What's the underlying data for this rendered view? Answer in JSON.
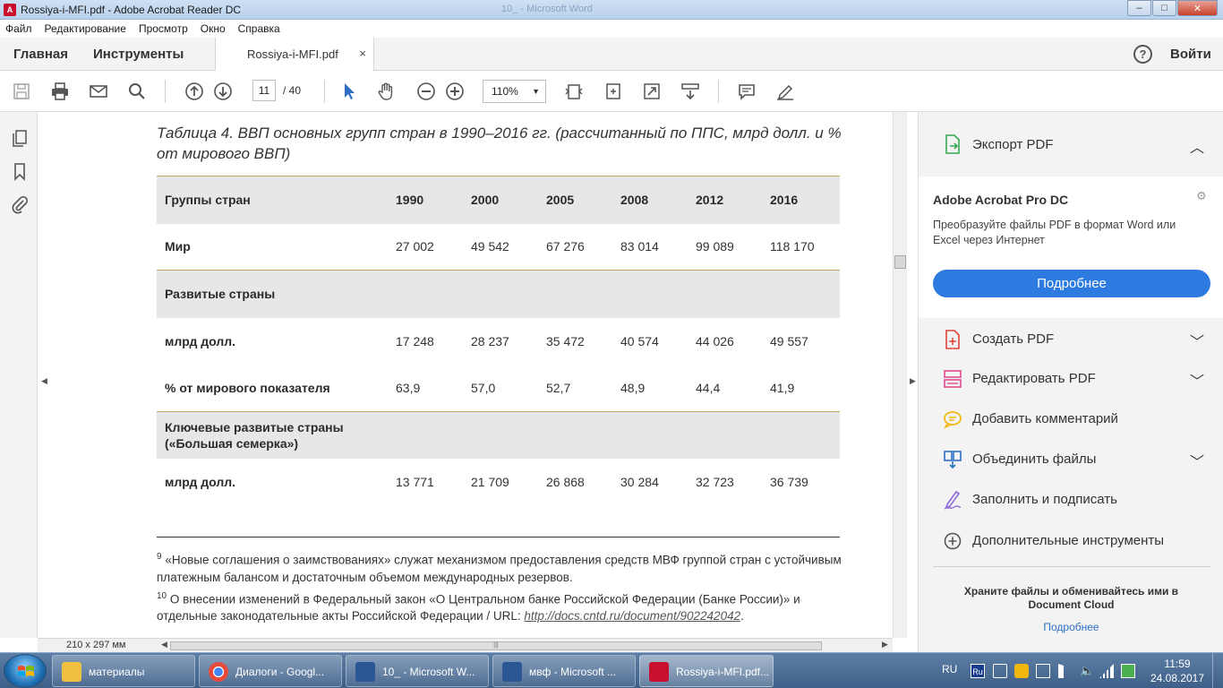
{
  "window": {
    "title": "Rossiya-i-MFI.pdf - Adobe Acrobat Reader DC",
    "ghost_title": "10_ - Microsoft Word",
    "controls": {
      "minimize": "–",
      "maximize": "□",
      "close": "✕"
    }
  },
  "menu": [
    "Файл",
    "Редактирование",
    "Просмотр",
    "Окно",
    "Справка"
  ],
  "nav": {
    "home": "Главная",
    "tools": "Инструменты",
    "doc_tab": "Rossiya-i-MFI.pdf",
    "close_tab": "×",
    "help": "?",
    "login": "Войти"
  },
  "toolbar": {
    "page_current": "11",
    "page_total": "/  40",
    "zoom": "110%"
  },
  "document": {
    "caption": "Таблица 4. ВВП основных групп стран в 1990–2016 гг. (рассчитанный по ППС, млрд долл. и % от мирового ВВП)",
    "header": {
      "label": "Группы стран",
      "years": [
        "1990",
        "2000",
        "2005",
        "2008",
        "2012",
        "2016"
      ]
    },
    "rows": [
      {
        "label": "Мир",
        "values": [
          "27 002",
          "49 542",
          "67 276",
          "83 014",
          "99 089",
          "118 170"
        ]
      },
      {
        "label": "Развитые страны",
        "values": []
      },
      {
        "label": "млрд долл.",
        "values": [
          "17 248",
          "28 237",
          "35 472",
          "40 574",
          "44 026",
          "49 557"
        ]
      },
      {
        "label": "% от мирового показателя",
        "values": [
          "63,9",
          "57,0",
          "52,7",
          "48,9",
          "44,4",
          "41,9"
        ]
      },
      {
        "label": "Ключевые развитые страны\n(«Большая семерка»)",
        "values": []
      },
      {
        "label": "млрд долл.",
        "values": [
          "13 771",
          "21 709",
          "26 868",
          "30 284",
          "32 723",
          "36 739"
        ]
      }
    ],
    "footnotes": [
      {
        "num": "9",
        "text": "«Новые соглашения о заимствованиях» служат механизмом предоставления средств МВФ группой стран с устойчивым платежным балансом и достаточным объемом международных резервов."
      },
      {
        "num": "10",
        "text": "О внесении изменений в Федеральный закон «О Центральном банке Российской Федерации (Банке России)» и отдельные законодательные акты Российской Федерации / URL: ",
        "link": "http://docs.cntd.ru/document/902242042",
        "after": "."
      }
    ]
  },
  "status": {
    "page_size": "210 x 297 мм"
  },
  "right_panel": {
    "export_label": "Экспорт PDF",
    "promo_title": "Adobe Acrobat Pro DC",
    "promo_desc": "Преобразуйте файлы PDF в формат Word или Excel через Интернет",
    "promo_button": "Подробнее",
    "tools": [
      {
        "label": "Создать PDF",
        "expandable": true,
        "color": "#e0433a"
      },
      {
        "label": "Редактировать PDF",
        "expandable": true,
        "color": "#e04a8c"
      },
      {
        "label": "Добавить комментарий",
        "expandable": false,
        "color": "#f2b80f"
      },
      {
        "label": "Объединить файлы",
        "expandable": true,
        "color": "#2d6fc4"
      },
      {
        "label": "Заполнить и подписать",
        "expandable": false,
        "color": "#8f6ad8"
      },
      {
        "label": "Дополнительные инструменты",
        "expandable": false,
        "color": "#555555"
      }
    ],
    "cloud_title": "Храните файлы и обменивайтесь ими в Document Cloud",
    "cloud_link": "Подробнее"
  },
  "taskbar": {
    "tasks": [
      {
        "label": "материалы",
        "icon": "folder-icon",
        "color": "#f0c040"
      },
      {
        "label": "Диалоги - Googl...",
        "icon": "chrome-icon",
        "color": "#e84a3a"
      },
      {
        "label": "10_ - Microsoft W...",
        "icon": "word-icon",
        "color": "#2b5797"
      },
      {
        "label": "мвф - Microsoft ...",
        "icon": "word-icon",
        "color": "#2b5797"
      },
      {
        "label": "Rossiya-i-MFI.pdf...",
        "icon": "acrobat-icon",
        "color": "#c8102e"
      }
    ],
    "lang": "RU",
    "time": "11:59",
    "date": "24.08.2017"
  }
}
